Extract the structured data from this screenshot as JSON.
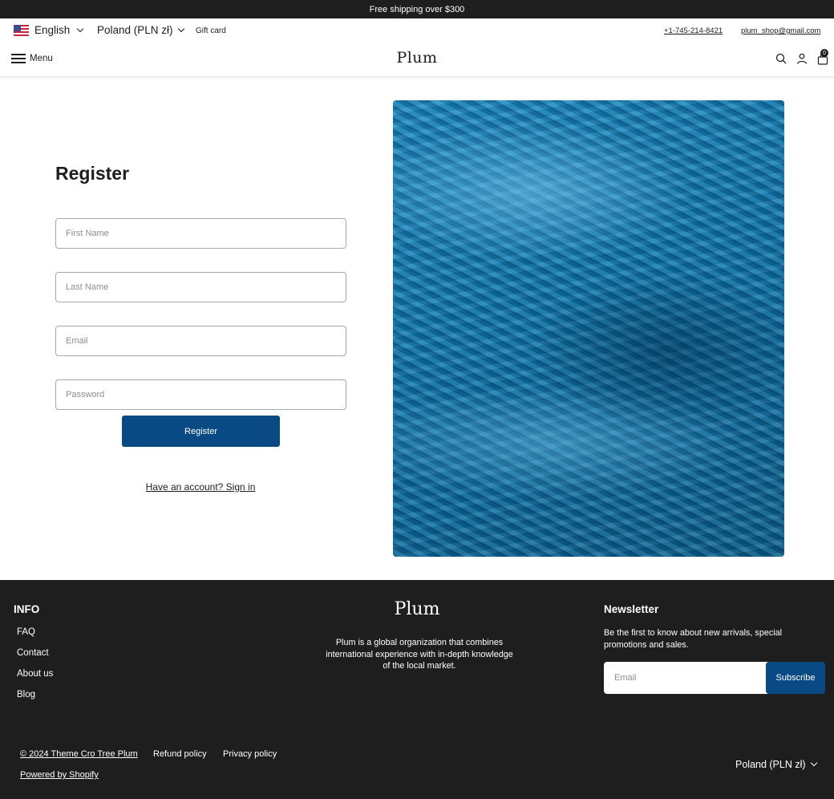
{
  "announcement": "Free shipping over $300",
  "topbar": {
    "language": "English",
    "currency": "Poland (PLN zł)",
    "gift_card": "Gift card",
    "phone": "+1-745-214-8421",
    "email": "plum_shop@gmail.com"
  },
  "header": {
    "menu_label": "Menu",
    "logo": "Plum",
    "cart_count": "0",
    "icons": [
      "search-icon",
      "account-icon",
      "cart-icon",
      "menu-icon",
      "flag-us-icon"
    ]
  },
  "register": {
    "title": "Register",
    "first_name_placeholder": "First Name",
    "last_name_placeholder": "Last Name",
    "email_placeholder": "Email",
    "password_placeholder": "Password",
    "submit_label": "Register",
    "signin_link": "Have an account? Sign in"
  },
  "footer": {
    "info_title": "INFO",
    "links": [
      "FAQ",
      "Contact",
      "About us",
      "Blog"
    ],
    "logo": "Plum",
    "description": "Plum is a global organization that combines international experience with in-depth knowledge of the local market.",
    "newsletter_title": "Newsletter",
    "newsletter_desc": "Be the first to know about new arrivals, special promotions and sales.",
    "newsletter_placeholder": "Email",
    "subscribe_label": "Subscribe",
    "copyright": "© 2024 Theme Cro Tree Plum",
    "refund_policy": "Refund policy",
    "privacy_policy": "Privacy policy",
    "powered_by": "Powered by Shopify",
    "currency": "Poland (PLN zł)"
  },
  "colors": {
    "accent": "#0a4a84",
    "dark": "#1e1e1e",
    "hero_blue": "#1178ad"
  }
}
